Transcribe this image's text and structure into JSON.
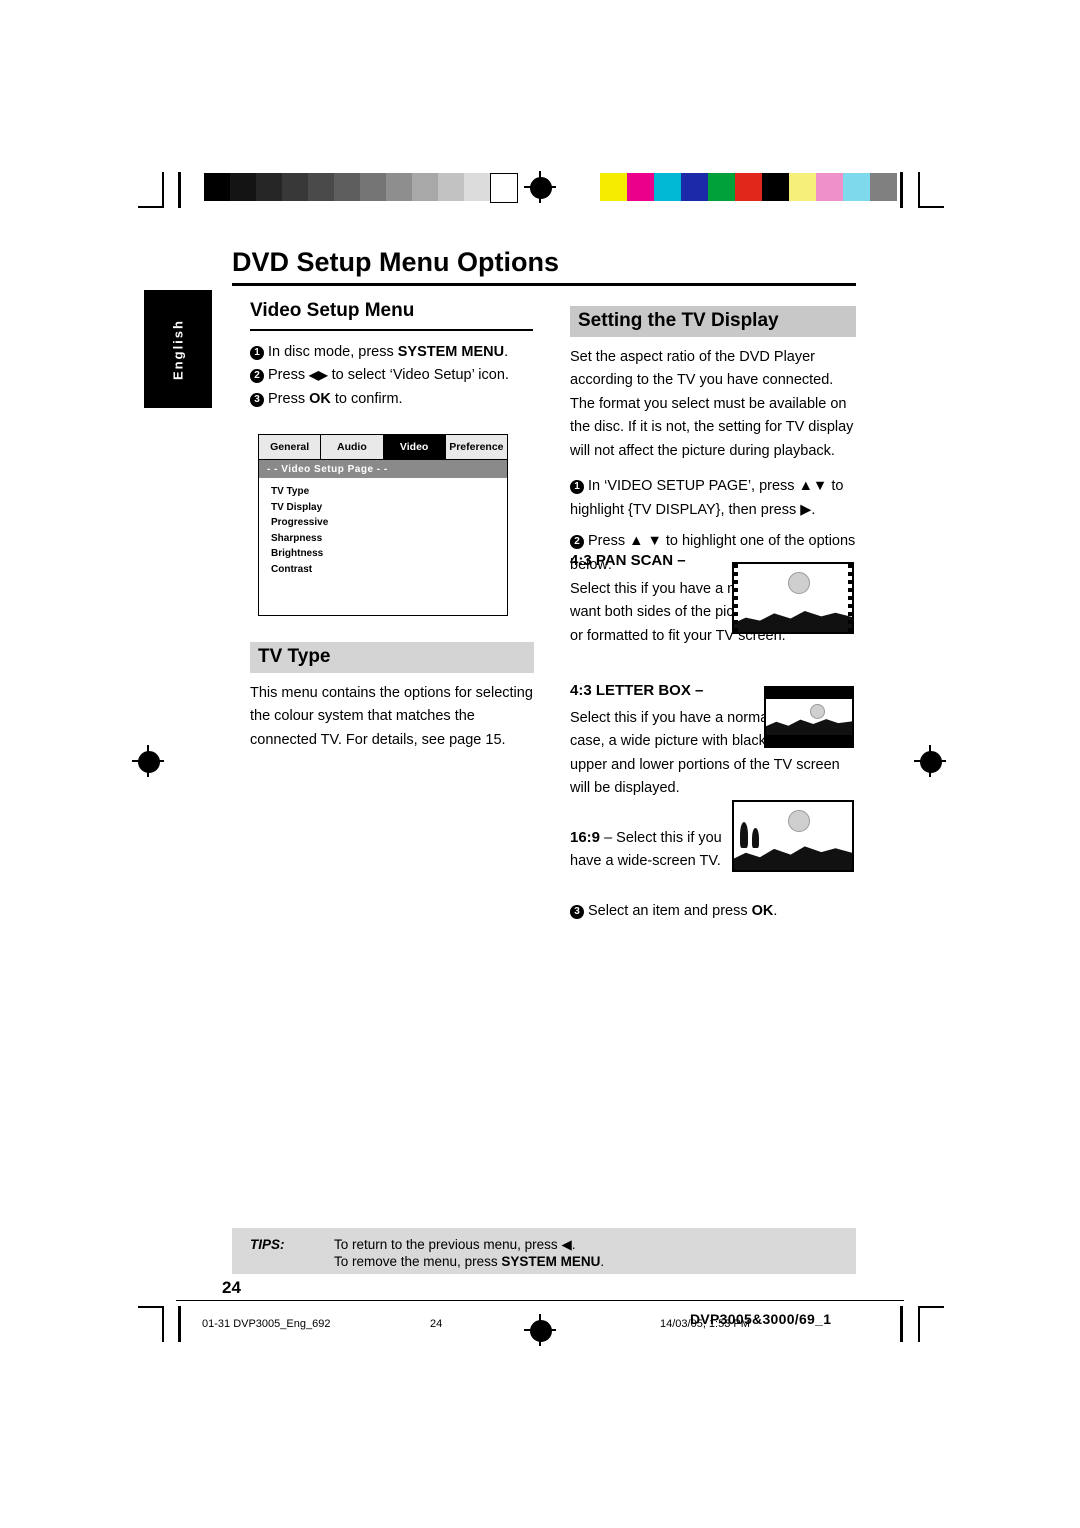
{
  "page": {
    "title": "DVD Setup Menu Options",
    "language_tab": "English",
    "page_number": "24"
  },
  "left_column": {
    "section_title": "Video Setup Menu",
    "steps": [
      {
        "num": "1",
        "text_before": "In disc mode, press ",
        "bold": "SYSTEM MENU",
        "text_after": "."
      },
      {
        "num": "2",
        "text_before": "Press ",
        "bold": "◀▶",
        "text_after": " to select ‘Video Setup’ icon."
      },
      {
        "num": "3",
        "text_before": "Press ",
        "bold": "OK",
        "text_after": " to confirm."
      }
    ],
    "osd": {
      "tabs": [
        "General",
        "Audio",
        "Video",
        "Preference"
      ],
      "active_tab": "Video",
      "subheader": "- -  Video Setup Page  - -",
      "items": [
        "TV Type",
        "TV Display",
        "Progressive",
        "Sharpness",
        "Brightness",
        "Contrast"
      ]
    },
    "tv_type": {
      "heading": "TV Type",
      "body": "This menu contains the options for selecting the colour system that matches the connected TV.  For details, see page 15."
    }
  },
  "right_column": {
    "heading": "Setting the TV Display",
    "intro": "Set the aspect ratio of the DVD Player according to the TV you have connected. The format you select must be available on the disc.  If it is not, the setting for TV display will not affect the picture during playback.",
    "steps": [
      {
        "num": "1",
        "text": "In ‘VIDEO SETUP PAGE’, press ▲▼ to highlight {TV DISPLAY}, then press ▶."
      },
      {
        "num": "2",
        "text": "Press ▲ ▼ to highlight one of the options below:"
      }
    ],
    "options": [
      {
        "label": "4:3 PAN SCAN",
        "dash": "–",
        "text": "Select this if you have a normal TV and want both sides of the picture to be trimmed or formatted to fit your TV screen."
      },
      {
        "label": "4:3 LETTER BOX",
        "dash": "–",
        "text": "Select this if you have a normal TV. In this case, a wide picture with black bands on the upper and lower portions of the TV screen will be displayed."
      },
      {
        "label": "16:9",
        "dash": "–",
        "text": "Select this if you have a wide-screen TV."
      }
    ],
    "final_step": {
      "num": "3",
      "text_before": "Select an item and press ",
      "bold": "OK",
      "text_after": "."
    }
  },
  "tips": {
    "label": "TIPS:",
    "line1": "To return to the previous menu, press ◀.",
    "line2_before": "To remove the menu, press ",
    "line2_bold": "SYSTEM MENU",
    "line2_after": "."
  },
  "footer": {
    "file": "01-31 DVP3005_Eng_692",
    "page": "24",
    "date": "14/03/05, 1:53 PM",
    "model": "DVP3005&3000/69_1"
  },
  "colors": {
    "gradient_swatches": [
      "#000000",
      "#141414",
      "#262626",
      "#383838",
      "#4a4a4a",
      "#5e5e5e",
      "#757575",
      "#8e8e8e",
      "#a8a8a8",
      "#c2c2c2",
      "#dcdcdc",
      "#ffffff"
    ],
    "color_swatches": [
      "#f5ec00",
      "#ea008a",
      "#00b7d4",
      "#1b2aa8",
      "#00a13a",
      "#e1261c",
      "#000000",
      "#f6f07a",
      "#ef90c8",
      "#7fd9ec",
      "#808080"
    ]
  }
}
